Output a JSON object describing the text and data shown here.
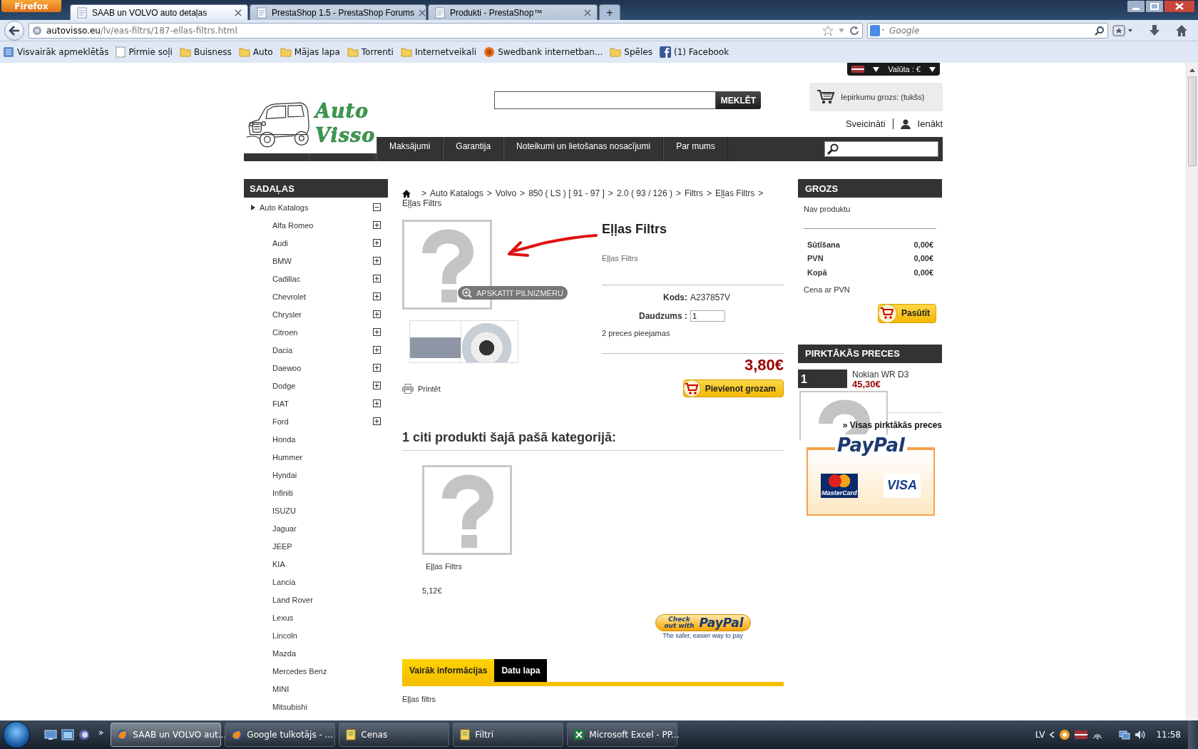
{
  "browser": {
    "firefox_button": "Firefox",
    "tabs": [
      {
        "title": "SAAB un VOLVO auto detaļas",
        "selected": true
      },
      {
        "title": "PrestaShop 1.5 - PrestaShop Forums",
        "selected": false
      },
      {
        "title": "Produkti - PrestaShop™",
        "selected": false
      }
    ],
    "new_tab": "+",
    "address": {
      "host": "autovisso.eu",
      "path": "/lv/eas-filtrs/187-ellas-filtrs.html"
    },
    "search": {
      "placeholder": "Google"
    },
    "bookmarks": [
      {
        "label": "Visvairāk apmeklētās",
        "kind": "smart"
      },
      {
        "label": "Pirmie soļi",
        "kind": "page"
      },
      {
        "label": "Buisness",
        "kind": "folder"
      },
      {
        "label": "Auto",
        "kind": "folder"
      },
      {
        "label": "Mājas lapa",
        "kind": "folder"
      },
      {
        "label": "Torrenti",
        "kind": "folder"
      },
      {
        "label": "Internetveikali",
        "kind": "folder"
      },
      {
        "label": "Swedbank internetban...",
        "kind": "bank"
      },
      {
        "label": "Spēles",
        "kind": "folder"
      },
      {
        "label": "(1) Facebook",
        "kind": "social"
      }
    ]
  },
  "header": {
    "currency": "Valūta : €",
    "search_button": "MEKLĒT",
    "cart": "Iepirkumu grozs: (tukšs)",
    "greeting": "Sveicināti",
    "login": "Ienākt",
    "logo": [
      "Auto",
      "Visso"
    ],
    "menu": [
      "Maksājumi",
      "Garantija",
      "Noteikumi un lietošanas nosacījumi",
      "Par mums"
    ]
  },
  "sidebar": {
    "title": "SADAĻAS",
    "items": [
      {
        "label": "Auto Katalogs",
        "kind": "branch",
        "expanded": true,
        "children": [
          {
            "label": "Alfa Romeo",
            "kind": "branch",
            "expanded": false
          },
          {
            "label": "Audi",
            "kind": "branch",
            "expanded": false
          },
          {
            "label": "BMW",
            "kind": "branch",
            "expanded": false
          },
          {
            "label": "Cadillac",
            "kind": "branch",
            "expanded": false
          },
          {
            "label": "Chevrolet",
            "kind": "branch",
            "expanded": false
          },
          {
            "label": "Chrysler",
            "kind": "branch",
            "expanded": false
          },
          {
            "label": "Citroen",
            "kind": "branch",
            "expanded": false
          },
          {
            "label": "Dacia",
            "kind": "branch",
            "expanded": false
          },
          {
            "label": "Daewoo",
            "kind": "branch",
            "expanded": false
          },
          {
            "label": "Dodge",
            "kind": "branch",
            "expanded": false
          },
          {
            "label": "FIAT",
            "kind": "branch",
            "expanded": false
          },
          {
            "label": "Ford",
            "kind": "branch",
            "expanded": false
          },
          {
            "label": "Honda",
            "kind": "leaf"
          },
          {
            "label": "Hummer",
            "kind": "leaf"
          },
          {
            "label": "Hyndai",
            "kind": "leaf"
          },
          {
            "label": "Infiniti",
            "kind": "leaf"
          },
          {
            "label": "ISUZU",
            "kind": "leaf"
          },
          {
            "label": "Jaguar",
            "kind": "leaf"
          },
          {
            "label": "JEEP",
            "kind": "leaf"
          },
          {
            "label": "KIA",
            "kind": "leaf"
          },
          {
            "label": "Lancia",
            "kind": "leaf"
          },
          {
            "label": "Land Rover",
            "kind": "leaf"
          },
          {
            "label": "Lexus",
            "kind": "leaf"
          },
          {
            "label": "Lincoln",
            "kind": "leaf"
          },
          {
            "label": "Mazda",
            "kind": "leaf"
          },
          {
            "label": "Mercedes Benz",
            "kind": "leaf"
          },
          {
            "label": "MINI",
            "kind": "leaf"
          },
          {
            "label": "Mitsubishi",
            "kind": "leaf"
          }
        ]
      }
    ]
  },
  "breadcrumb": {
    "separator": ">",
    "items": [
      "Auto Katalogs",
      "Volvo",
      "850 ( LS ) [ 91 - 97 ]",
      "2.0 ( 93 / 126 )",
      "Filtrs",
      "Eļļas Filtrs"
    ],
    "current": "Eļļas Filtrs"
  },
  "product": {
    "zoom_button": "APSKATĪT PILNIZMĒRU",
    "title": "Eļļas Filtrs",
    "short_description": "Eļļas Filtrs",
    "code_label": "Kods:",
    "code": "A237857V",
    "quantity_label": "Daudzums :",
    "quantity": "1",
    "availability": "2 preces pieejamas",
    "price": "3,80€",
    "add_button": "Pievienot grozam",
    "print": "Printēt"
  },
  "related": {
    "title": "1 citi produkti šajā pašā kategorijā:",
    "items": [
      {
        "name": "Eļļas Filtrs",
        "price": "5,12€"
      }
    ]
  },
  "paypal_checkout": {
    "label": "Check out with",
    "logo": "PayPal",
    "tagline": "The safer, easier way to pay"
  },
  "info_tabs": [
    {
      "label": "Vairāk informācijas",
      "selected": true
    },
    {
      "label": "Datu lapa",
      "selected": false
    }
  ],
  "info_text": "Eļļas filtrs",
  "cart_block": {
    "title": "GROZS",
    "empty": "Nav produktu",
    "rows": [
      {
        "label": "Sūtīšana",
        "value": "0,00€"
      },
      {
        "label": "PVN",
        "value": "0,00€"
      },
      {
        "label": "Kopā",
        "value": "0,00€"
      }
    ],
    "note": "Cena ar PVN",
    "button": "Pasūtīt"
  },
  "bestsellers": {
    "title": "PIRKTĀKĀS PRECES",
    "items": [
      {
        "rank": "1",
        "name": "Nokian WR D3",
        "price": "45,30€"
      }
    ],
    "link": "» Visas pirktākās preces"
  },
  "payment_logos": {
    "brand": "PayPal",
    "cards": [
      "MasterCard",
      "VISA"
    ]
  },
  "taskbar": {
    "more": "»",
    "items": [
      {
        "label": "SAAB un VOLVO aut...",
        "kind": "browser",
        "selected": true
      },
      {
        "label": "Google tulkotājs - ...",
        "kind": "browser",
        "selected": false
      },
      {
        "label": "Cenas",
        "kind": "folder",
        "selected": false
      },
      {
        "label": "Filtri",
        "kind": "folder",
        "selected": false
      },
      {
        "label": "Microsoft Excel - PP...",
        "kind": "spreadsheet",
        "selected": false
      }
    ],
    "language": "LV",
    "time": "11:58"
  }
}
